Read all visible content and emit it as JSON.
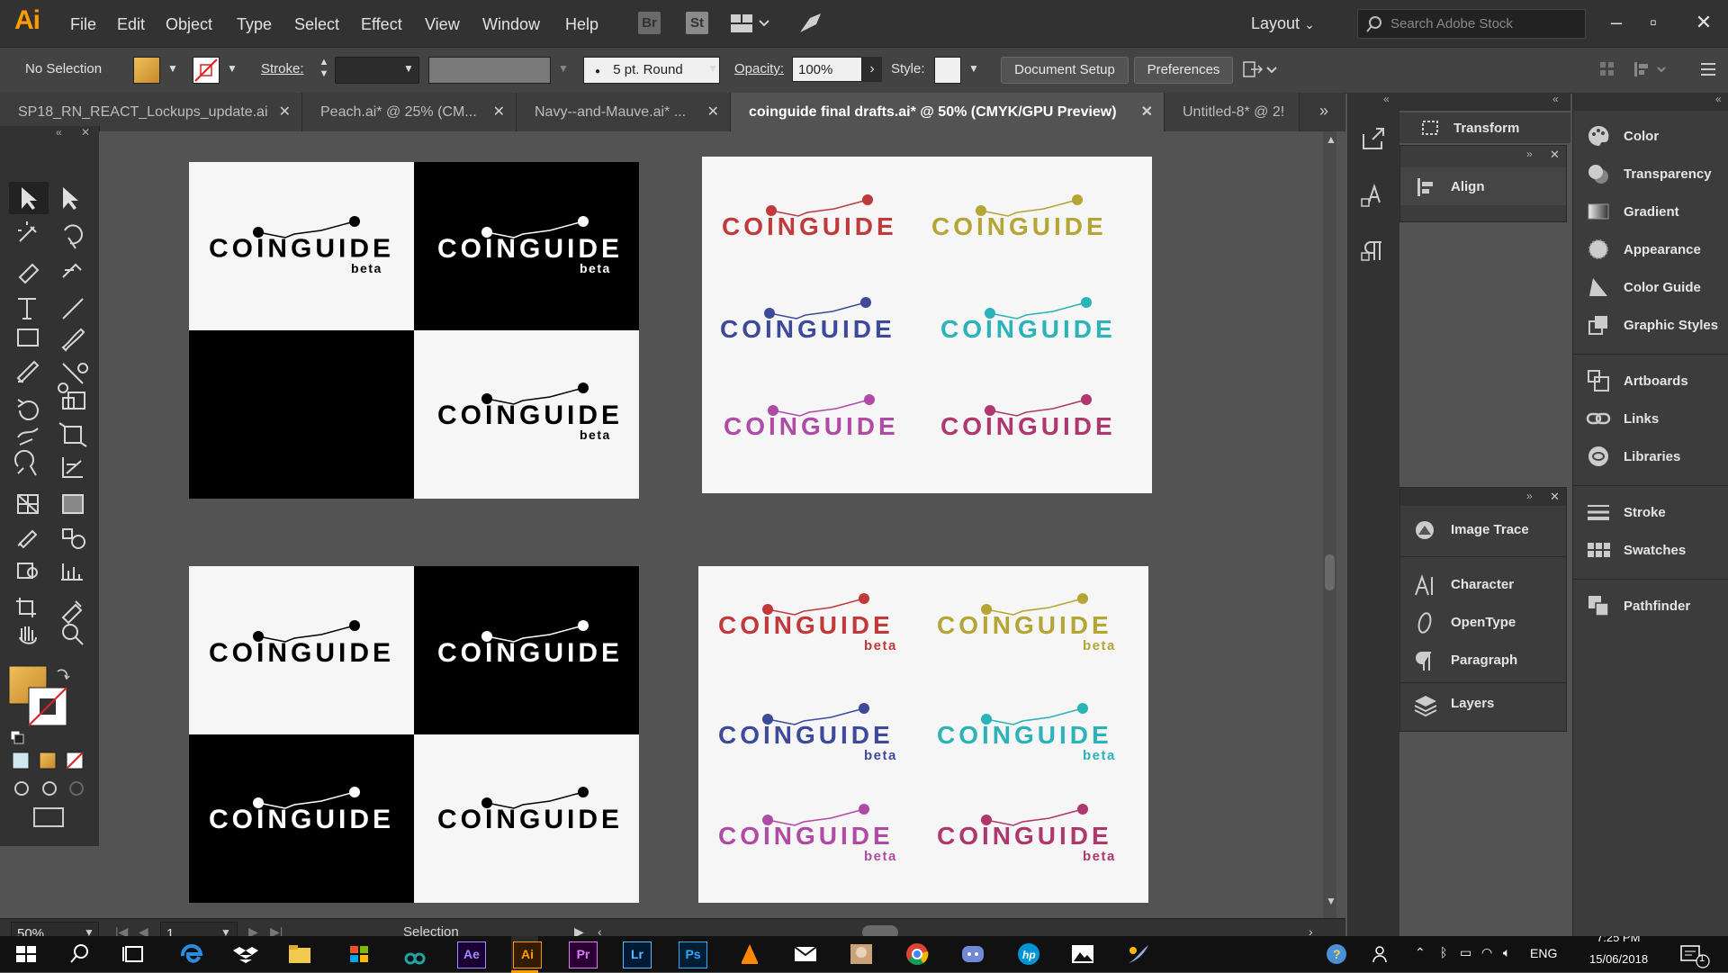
{
  "app": {
    "logo": "Ai",
    "menu": [
      "File",
      "Edit",
      "Object",
      "Type",
      "Select",
      "Effect",
      "View",
      "Window",
      "Help"
    ],
    "bridge_chip": "Br",
    "stock_chip": "St",
    "workspace": "Layout",
    "search_placeholder": "Search Adobe Stock"
  },
  "control_bar": {
    "selection_label": "No Selection",
    "stroke_label": "Stroke:",
    "brush_value": "5 pt. Round",
    "opacity_label": "Opacity:",
    "opacity_value": "100%",
    "style_label": "Style:",
    "document_setup": "Document Setup",
    "preferences": "Preferences"
  },
  "tabs": [
    {
      "label": "SP18_RN_REACT_Lockups_update.ai"
    },
    {
      "label": "Peach.ai* @ 25% (CM..."
    },
    {
      "label": "Navy--and-Mauve.ai* ..."
    },
    {
      "label": "coinguide final drafts.ai* @ 50% (CMYK/GPU Preview)"
    },
    {
      "label": "Untitled-8* @ 2!"
    }
  ],
  "colors": {
    "red": "#c0393b",
    "olive": "#b5a534",
    "navy": "#3d4a9a",
    "teal": "#2ab3b8",
    "purple": "#b04ba5",
    "magenta": "#b0366e",
    "fill_swatch": "#d9a63a"
  },
  "logos": {
    "word": "COINGUIDE",
    "sub": "beta"
  },
  "panels_left": {
    "transform": "Transform",
    "align": "Align",
    "image_trace": "Image Trace",
    "character": "Character",
    "opentype": "OpenType",
    "paragraph": "Paragraph",
    "layers": "Layers"
  },
  "panels_right": [
    "Color",
    "Transparency",
    "Gradient",
    "Appearance",
    "Color Guide",
    "Graphic Styles",
    "Artboards",
    "Links",
    "Libraries",
    "Stroke",
    "Swatches",
    "Pathfinder"
  ],
  "status": {
    "zoom": "50%",
    "page": "1",
    "mode": "Selection"
  },
  "taskbar": {
    "lang": "ENG",
    "time": "7:25 PM",
    "date": "15/06/2018",
    "notifications": "1"
  }
}
